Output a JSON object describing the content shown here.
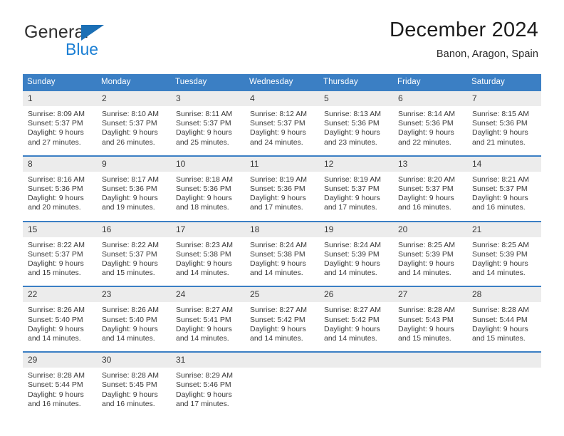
{
  "brand": {
    "name_part1": "General",
    "name_part2": "Blue",
    "accent_color": "#1b7fd4",
    "triangle_color": "#1b6fb5"
  },
  "header": {
    "title": "December 2024",
    "subtitle": "Banon, Aragon, Spain"
  },
  "calendar": {
    "header_bg": "#3b7fc4",
    "daynum_bg": "#ececec",
    "weekday_headers": [
      "Sunday",
      "Monday",
      "Tuesday",
      "Wednesday",
      "Thursday",
      "Friday",
      "Saturday"
    ],
    "weeks": [
      [
        {
          "day": "1",
          "sunrise": "Sunrise: 8:09 AM",
          "sunset": "Sunset: 5:37 PM",
          "daylight_1": "Daylight: 9 hours",
          "daylight_2": "and 27 minutes."
        },
        {
          "day": "2",
          "sunrise": "Sunrise: 8:10 AM",
          "sunset": "Sunset: 5:37 PM",
          "daylight_1": "Daylight: 9 hours",
          "daylight_2": "and 26 minutes."
        },
        {
          "day": "3",
          "sunrise": "Sunrise: 8:11 AM",
          "sunset": "Sunset: 5:37 PM",
          "daylight_1": "Daylight: 9 hours",
          "daylight_2": "and 25 minutes."
        },
        {
          "day": "4",
          "sunrise": "Sunrise: 8:12 AM",
          "sunset": "Sunset: 5:37 PM",
          "daylight_1": "Daylight: 9 hours",
          "daylight_2": "and 24 minutes."
        },
        {
          "day": "5",
          "sunrise": "Sunrise: 8:13 AM",
          "sunset": "Sunset: 5:36 PM",
          "daylight_1": "Daylight: 9 hours",
          "daylight_2": "and 23 minutes."
        },
        {
          "day": "6",
          "sunrise": "Sunrise: 8:14 AM",
          "sunset": "Sunset: 5:36 PM",
          "daylight_1": "Daylight: 9 hours",
          "daylight_2": "and 22 minutes."
        },
        {
          "day": "7",
          "sunrise": "Sunrise: 8:15 AM",
          "sunset": "Sunset: 5:36 PM",
          "daylight_1": "Daylight: 9 hours",
          "daylight_2": "and 21 minutes."
        }
      ],
      [
        {
          "day": "8",
          "sunrise": "Sunrise: 8:16 AM",
          "sunset": "Sunset: 5:36 PM",
          "daylight_1": "Daylight: 9 hours",
          "daylight_2": "and 20 minutes."
        },
        {
          "day": "9",
          "sunrise": "Sunrise: 8:17 AM",
          "sunset": "Sunset: 5:36 PM",
          "daylight_1": "Daylight: 9 hours",
          "daylight_2": "and 19 minutes."
        },
        {
          "day": "10",
          "sunrise": "Sunrise: 8:18 AM",
          "sunset": "Sunset: 5:36 PM",
          "daylight_1": "Daylight: 9 hours",
          "daylight_2": "and 18 minutes."
        },
        {
          "day": "11",
          "sunrise": "Sunrise: 8:19 AM",
          "sunset": "Sunset: 5:36 PM",
          "daylight_1": "Daylight: 9 hours",
          "daylight_2": "and 17 minutes."
        },
        {
          "day": "12",
          "sunrise": "Sunrise: 8:19 AM",
          "sunset": "Sunset: 5:37 PM",
          "daylight_1": "Daylight: 9 hours",
          "daylight_2": "and 17 minutes."
        },
        {
          "day": "13",
          "sunrise": "Sunrise: 8:20 AM",
          "sunset": "Sunset: 5:37 PM",
          "daylight_1": "Daylight: 9 hours",
          "daylight_2": "and 16 minutes."
        },
        {
          "day": "14",
          "sunrise": "Sunrise: 8:21 AM",
          "sunset": "Sunset: 5:37 PM",
          "daylight_1": "Daylight: 9 hours",
          "daylight_2": "and 16 minutes."
        }
      ],
      [
        {
          "day": "15",
          "sunrise": "Sunrise: 8:22 AM",
          "sunset": "Sunset: 5:37 PM",
          "daylight_1": "Daylight: 9 hours",
          "daylight_2": "and 15 minutes."
        },
        {
          "day": "16",
          "sunrise": "Sunrise: 8:22 AM",
          "sunset": "Sunset: 5:37 PM",
          "daylight_1": "Daylight: 9 hours",
          "daylight_2": "and 15 minutes."
        },
        {
          "day": "17",
          "sunrise": "Sunrise: 8:23 AM",
          "sunset": "Sunset: 5:38 PM",
          "daylight_1": "Daylight: 9 hours",
          "daylight_2": "and 14 minutes."
        },
        {
          "day": "18",
          "sunrise": "Sunrise: 8:24 AM",
          "sunset": "Sunset: 5:38 PM",
          "daylight_1": "Daylight: 9 hours",
          "daylight_2": "and 14 minutes."
        },
        {
          "day": "19",
          "sunrise": "Sunrise: 8:24 AM",
          "sunset": "Sunset: 5:39 PM",
          "daylight_1": "Daylight: 9 hours",
          "daylight_2": "and 14 minutes."
        },
        {
          "day": "20",
          "sunrise": "Sunrise: 8:25 AM",
          "sunset": "Sunset: 5:39 PM",
          "daylight_1": "Daylight: 9 hours",
          "daylight_2": "and 14 minutes."
        },
        {
          "day": "21",
          "sunrise": "Sunrise: 8:25 AM",
          "sunset": "Sunset: 5:39 PM",
          "daylight_1": "Daylight: 9 hours",
          "daylight_2": "and 14 minutes."
        }
      ],
      [
        {
          "day": "22",
          "sunrise": "Sunrise: 8:26 AM",
          "sunset": "Sunset: 5:40 PM",
          "daylight_1": "Daylight: 9 hours",
          "daylight_2": "and 14 minutes."
        },
        {
          "day": "23",
          "sunrise": "Sunrise: 8:26 AM",
          "sunset": "Sunset: 5:40 PM",
          "daylight_1": "Daylight: 9 hours",
          "daylight_2": "and 14 minutes."
        },
        {
          "day": "24",
          "sunrise": "Sunrise: 8:27 AM",
          "sunset": "Sunset: 5:41 PM",
          "daylight_1": "Daylight: 9 hours",
          "daylight_2": "and 14 minutes."
        },
        {
          "day": "25",
          "sunrise": "Sunrise: 8:27 AM",
          "sunset": "Sunset: 5:42 PM",
          "daylight_1": "Daylight: 9 hours",
          "daylight_2": "and 14 minutes."
        },
        {
          "day": "26",
          "sunrise": "Sunrise: 8:27 AM",
          "sunset": "Sunset: 5:42 PM",
          "daylight_1": "Daylight: 9 hours",
          "daylight_2": "and 14 minutes."
        },
        {
          "day": "27",
          "sunrise": "Sunrise: 8:28 AM",
          "sunset": "Sunset: 5:43 PM",
          "daylight_1": "Daylight: 9 hours",
          "daylight_2": "and 15 minutes."
        },
        {
          "day": "28",
          "sunrise": "Sunrise: 8:28 AM",
          "sunset": "Sunset: 5:44 PM",
          "daylight_1": "Daylight: 9 hours",
          "daylight_2": "and 15 minutes."
        }
      ],
      [
        {
          "day": "29",
          "sunrise": "Sunrise: 8:28 AM",
          "sunset": "Sunset: 5:44 PM",
          "daylight_1": "Daylight: 9 hours",
          "daylight_2": "and 16 minutes."
        },
        {
          "day": "30",
          "sunrise": "Sunrise: 8:28 AM",
          "sunset": "Sunset: 5:45 PM",
          "daylight_1": "Daylight: 9 hours",
          "daylight_2": "and 16 minutes."
        },
        {
          "day": "31",
          "sunrise": "Sunrise: 8:29 AM",
          "sunset": "Sunset: 5:46 PM",
          "daylight_1": "Daylight: 9 hours",
          "daylight_2": "and 17 minutes."
        },
        {
          "day": "",
          "sunrise": "",
          "sunset": "",
          "daylight_1": "",
          "daylight_2": ""
        },
        {
          "day": "",
          "sunrise": "",
          "sunset": "",
          "daylight_1": "",
          "daylight_2": ""
        },
        {
          "day": "",
          "sunrise": "",
          "sunset": "",
          "daylight_1": "",
          "daylight_2": ""
        },
        {
          "day": "",
          "sunrise": "",
          "sunset": "",
          "daylight_1": "",
          "daylight_2": ""
        }
      ]
    ]
  }
}
